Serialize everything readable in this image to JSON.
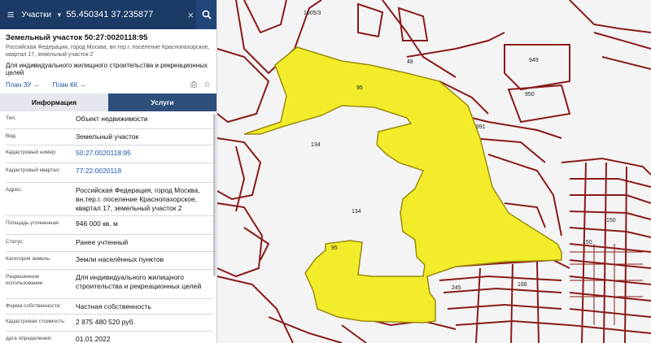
{
  "search": {
    "layer": "Участки",
    "coords": "55.450341 37.235877"
  },
  "parcel": {
    "title": "Земельный участок 50:27:0020118:95",
    "address": "Российская Федерация, город Москва, вн.тер.г. поселение Краснопахорское, квартал 17, земельный участок 2",
    "purpose": "Для индивидуального жилищного строительства и рекреационных целей",
    "link_zu": "План ЗУ →",
    "link_kk": "План КК →"
  },
  "tabs": {
    "info": "Информация",
    "services": "Услуги"
  },
  "info_rows": [
    {
      "key": "Тип:",
      "value": "Объект недвижимости"
    },
    {
      "key": "Вид:",
      "value": "Земельный участок"
    },
    {
      "key": "Кадастровый номер:",
      "value": "50:27:0020118:95"
    },
    {
      "key": "Кадастровый квартал:",
      "value": "77:22:0020118"
    },
    {
      "key": "Адрес:",
      "value": "Российская Федерация, город Москва, вн.тер.г. поселение Краснопахорское, квартал 17, земельный участок 2"
    },
    {
      "key": "Площадь уточненная:",
      "value": "946 000 кв. м"
    },
    {
      "key": "Статус:",
      "value": "Ранее учтенный"
    },
    {
      "key": "Категория земель:",
      "value": "Земли населённых пунктов"
    },
    {
      "key": "Разрешенное использование:",
      "value": "Для индивидуального жилищного строительства и рекреационных целей"
    },
    {
      "key": "Форма собственности:",
      "value": "Частная собственность"
    },
    {
      "key": "Кадастровая стоимость:",
      "value": "2 875 480 520 руб."
    },
    {
      "key": "дата определения:",
      "value": "01.01.2022"
    }
  ],
  "map": {
    "labels": [
      "95",
      "134",
      "134",
      "95",
      "949",
      "950",
      "48",
      "1005/3",
      "991",
      "245",
      "166",
      "150",
      "150"
    ],
    "colors": {
      "highlight_fill": "#f2ec2a",
      "highlight_stroke": "#9b8c10",
      "parcel_line": "#8a1a1a",
      "background": "#f4f4f4",
      "header": "#1b3a66",
      "link": "#1a56a8"
    }
  }
}
